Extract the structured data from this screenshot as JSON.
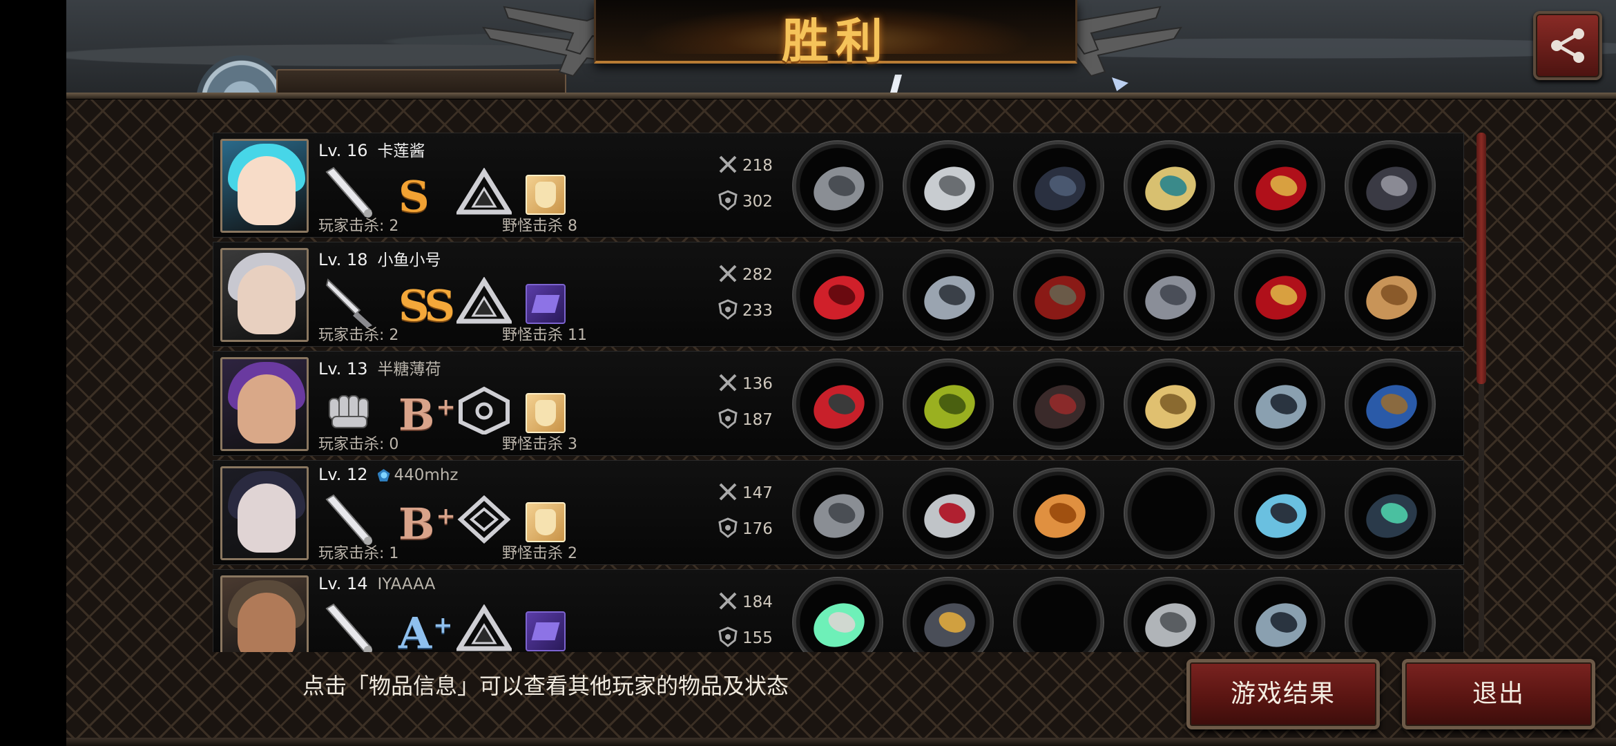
{
  "title": "胜利",
  "header": {
    "peek_name": "卡莲酱"
  },
  "hint": "点击「物品信息」可以查看其他玩家的物品及状态",
  "buttons": {
    "result": "游戏结果",
    "exit": "退出"
  },
  "players": [
    {
      "level": "Lv. 16",
      "name": "卡莲酱",
      "rank": "S",
      "rank_plus": "",
      "weapon": "bat",
      "bag": "gold",
      "player_kills": "玩家击杀: 2",
      "mob_kills": "野怪击杀 8",
      "attack": "218",
      "defense": "302",
      "items": [
        "statue-cape",
        "knight-helmet",
        "black-armor",
        "gold-bracelet",
        "red-heels",
        "black-flag"
      ]
    },
    {
      "level": "Lv. 18",
      "name": "小鱼小号",
      "rank": "SS",
      "rank_plus": "",
      "weapon": "knife",
      "bag": "purple",
      "player_kills": "玩家击杀: 2",
      "mob_kills": "野怪击杀 11",
      "attack": "282",
      "defense": "233",
      "items": [
        "red-sword",
        "tech-helmet",
        "red-cape-armor",
        "spiked-bracer",
        "red-heels",
        "cat-box"
      ]
    },
    {
      "level": "Lv. 13",
      "name": "半糖薄荷",
      "rank": "B",
      "rank_plus": "+",
      "weapon": "fist",
      "bag": "gold",
      "player_kills": "玩家击杀: 0",
      "mob_kills": "野怪击杀 3",
      "attack": "136",
      "defense": "187",
      "items": [
        "red-claw",
        "laurel-crown",
        "dark-bikini",
        "gold-shield",
        "steel-boots",
        "blue-flag"
      ]
    },
    {
      "level": "Lv. 12",
      "name": "440mhz",
      "rank": "B",
      "rank_plus": "+",
      "weapon": "bat",
      "bag": "gold",
      "player_kills": "玩家击杀: 1",
      "mob_kills": "野怪击杀 2",
      "attack": "147",
      "defense": "176",
      "items": [
        "statue-cape",
        "red-tiara",
        "gold-bikini",
        "",
        "tech-sneakers",
        "scope"
      ]
    },
    {
      "level": "Lv. 14",
      "name": "IYAAAA",
      "rank": "A",
      "rank_plus": "+",
      "weapon": "bat",
      "bag": "purple",
      "player_kills": "",
      "mob_kills": "",
      "attack": "184",
      "defense": "155",
      "items": [
        "twin-lightsaber",
        "plumed-helmet",
        "",
        "steel-plate",
        "steel-boots",
        ""
      ]
    }
  ],
  "colors": {
    "accent": "#f5c35a",
    "button": "#7a2320",
    "frame": "#6d5a48"
  }
}
